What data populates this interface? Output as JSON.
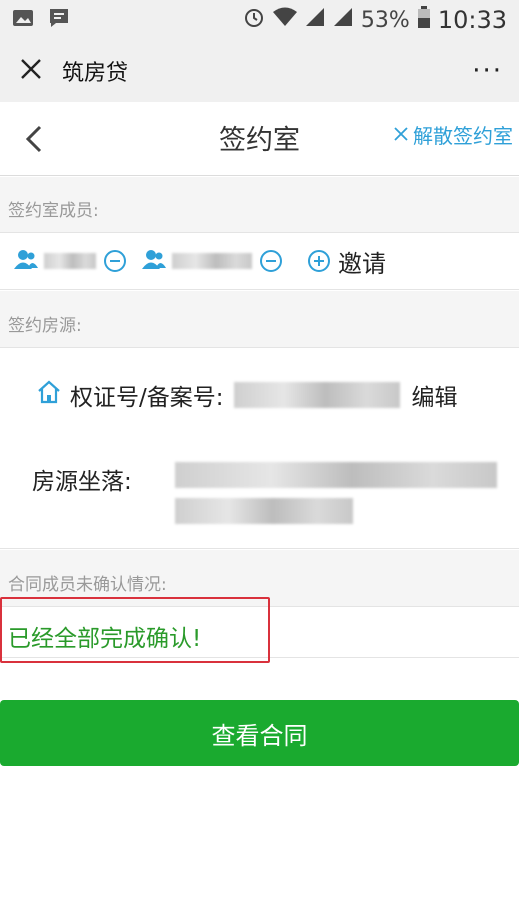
{
  "status_bar": {
    "battery": "53%",
    "time": "10:33"
  },
  "wechat_header": {
    "title": "筑房贷",
    "more": "···"
  },
  "page": {
    "title": "签约室",
    "dismiss_label": "解散签约室"
  },
  "members_section": {
    "label": "签约室成员:",
    "invite_label": "邀请"
  },
  "property_section": {
    "label": "签约房源:",
    "cert_label": "权证号/备案号:",
    "edit_label": "编辑",
    "location_label": "房源坐落:"
  },
  "confirm_section": {
    "label": "合同成员未确认情况:",
    "status": "已经全部完成确认!"
  },
  "action": {
    "view_contract": "查看合同"
  },
  "colors": {
    "accent": "#2fa0d8",
    "primary_button": "#1aaa2f",
    "success_text": "#2a9a2a",
    "highlight_frame": "#d9313c"
  }
}
